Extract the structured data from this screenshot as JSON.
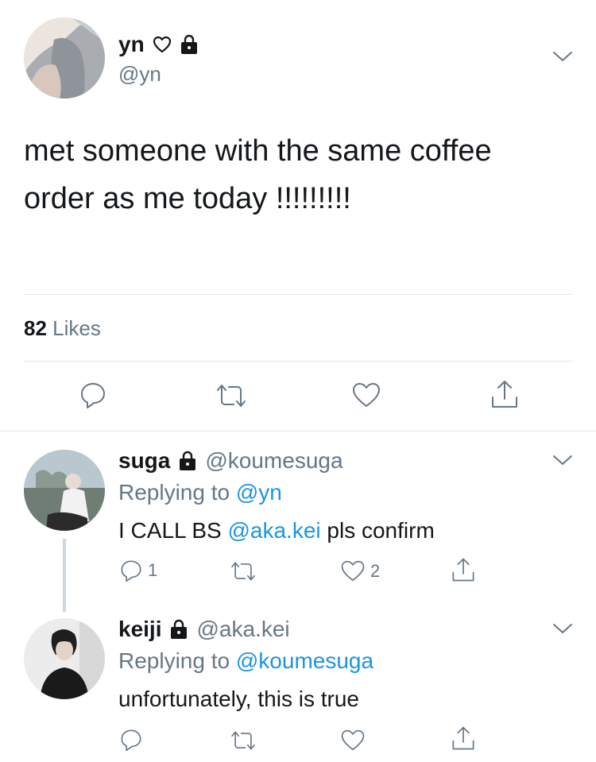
{
  "main_tweet": {
    "display_name": "yn",
    "handle": "@yn",
    "text_line1": "met someone with the same coffee",
    "text_line2": "order as me today !!!!!!!!!",
    "likes_count": "82",
    "likes_label": "Likes"
  },
  "replies": [
    {
      "display_name": "suga",
      "handle": "@koumesuga",
      "replying_prefix": "Replying to",
      "replying_to": "@yn",
      "text_before": "I CALL BS",
      "mention": "@aka.kei",
      "text_after": "pls confirm",
      "reply_count": "1",
      "like_count": "2"
    },
    {
      "display_name": "keiji",
      "handle": "@aka.kei",
      "replying_prefix": "Replying to",
      "replying_to": "@koumesuga",
      "text": "unfortunately, this is true"
    }
  ],
  "icons": [
    "heart-outline-icon",
    "lock-icon",
    "chevron-down-icon",
    "reply-icon",
    "retweet-icon",
    "like-icon",
    "share-icon"
  ],
  "colors": {
    "text": "#14171a",
    "secondary": "#657786",
    "link": "#1b95e0",
    "divider": "#e1e8ed"
  }
}
